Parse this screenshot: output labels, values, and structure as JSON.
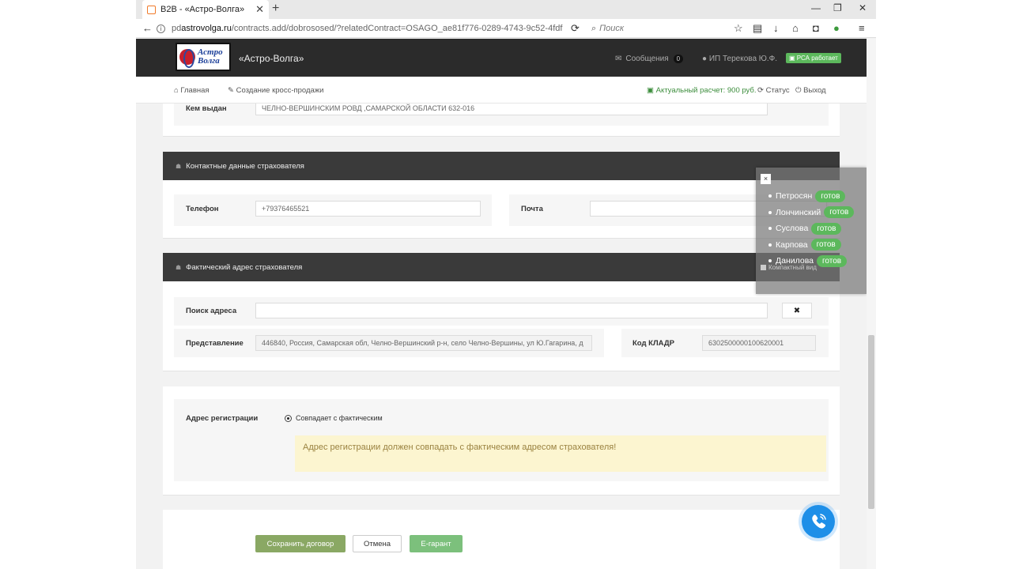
{
  "browser": {
    "tab_title": "B2B - «Астро-Волга»",
    "url_prefix": "pd",
    "url_host": "astrovolga.ru",
    "url_path": "/contracts.add/dobrososed/?relatedContract=OSAGO_ae81f776-0289-4743-9c52-4fdf",
    "search_placeholder": "Поиск"
  },
  "header": {
    "logo_line1": "Астро",
    "logo_line2": "Волга",
    "brand": "«Астро-Волга»",
    "messages": "Сообщения",
    "messages_count": "0",
    "user": "ИП Терекова Ю.Ф.",
    "rsa": "РСА работает"
  },
  "toolbar": {
    "home": "Главная",
    "cross": "Создание кросс-продажи",
    "calc": "Актуальный расчет: 900 руб.",
    "status": "Статус",
    "logout": "Выход"
  },
  "issued": {
    "label": "Кем выдан",
    "value": "ЧЕЛНО-ВЕРШИНСКИМ РОВД ,САМАРСКОЙ ОБЛАСТИ 632-016"
  },
  "contacts": {
    "title": "Контактные данные страхователя",
    "phone_label": "Телефон",
    "phone_value": "+79376465521",
    "mail_label": "Почта",
    "mail_value": ""
  },
  "address": {
    "title": "Фактический адрес страхователя",
    "search_label": "Поиск адреса",
    "search_value": "",
    "clear": "✖",
    "repr_label": "Представление",
    "repr_value": "446840, Россия, Самарская обл, Челно-Вершинский р-н, село Челно-Вершины, ул Ю.Гагарина, д",
    "kladr_label": "Код КЛАДР",
    "kladr_value": "6302500000100620001"
  },
  "registration": {
    "label": "Адрес регистрации",
    "radio": "Совпадает с фактическим",
    "warning": "Адрес регистрации должен совпадать с фактическим адресом страхователя!"
  },
  "buttons": {
    "save": "Сохранить договор",
    "cancel": "Отмена",
    "egarant": "Е-гарант"
  },
  "overlay": {
    "close": "×",
    "items": [
      {
        "name": "Петросян",
        "status": "готов"
      },
      {
        "name": "Лончинский",
        "status": "готов"
      },
      {
        "name": "Суслова",
        "status": "готов"
      },
      {
        "name": "Карпова",
        "status": "готов"
      },
      {
        "name": "Данилова",
        "status": "готов"
      }
    ],
    "compact": "Компактный вид"
  },
  "colors": {
    "header_bg": "#2b2b2b",
    "ready": "#5cb85c",
    "warning_bg": "#fcf5d0",
    "save_btn": "#8aa864",
    "phone_btn": "#1e8fe8"
  }
}
